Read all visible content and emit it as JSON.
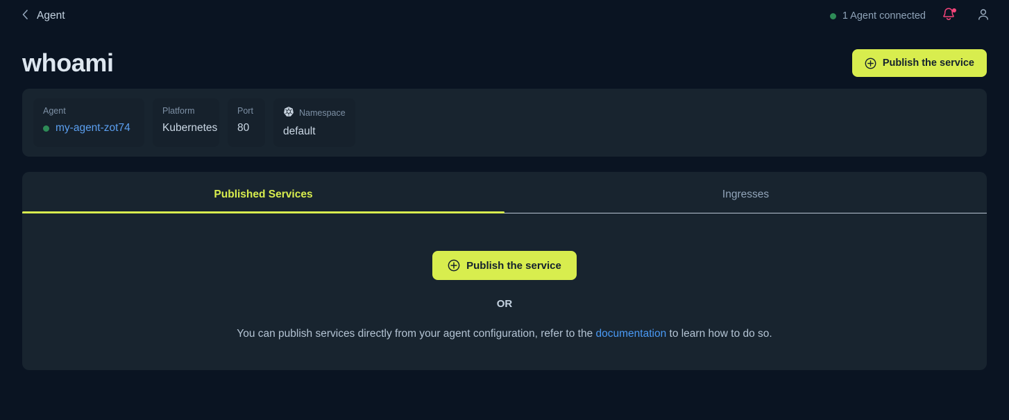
{
  "topbar": {
    "back_icon": "chevron-left-icon",
    "breadcrumb_label": "Agent",
    "connection_status": "1 Agent connected",
    "status_dot_color": "#2e8b57",
    "bell_icon": "bell-icon",
    "bell_color": "#f4447a",
    "notification_dot_color": "#f4447a",
    "user_icon": "user-icon"
  },
  "page": {
    "title": "whoami",
    "publish_button_label": "Publish the service",
    "publish_button_icon": "plus-circle-icon",
    "accent_color": "#d8ed4e"
  },
  "info": {
    "cards": [
      {
        "label": "Agent",
        "value": "my-agent-zot74",
        "icon": "",
        "status_dot": true,
        "is_link": true
      },
      {
        "label": "Platform",
        "value": "Kubernetes",
        "icon": "",
        "status_dot": false,
        "is_link": false
      },
      {
        "label": "Port",
        "value": "80",
        "icon": "",
        "status_dot": false,
        "is_link": false
      },
      {
        "label": "Namespace",
        "value": "default",
        "icon": "kubernetes-icon",
        "status_dot": false,
        "is_link": false
      }
    ]
  },
  "tabs": [
    {
      "label": "Published Services",
      "active": true
    },
    {
      "label": "Ingresses",
      "active": false
    }
  ],
  "empty_state": {
    "publish_button_label": "Publish the service",
    "publish_button_icon": "plus-circle-icon",
    "or_label": "OR",
    "description_before": "You can publish services directly from your agent configuration, refer to the ",
    "description_link": "documentation",
    "description_after": " to learn how to do so."
  }
}
